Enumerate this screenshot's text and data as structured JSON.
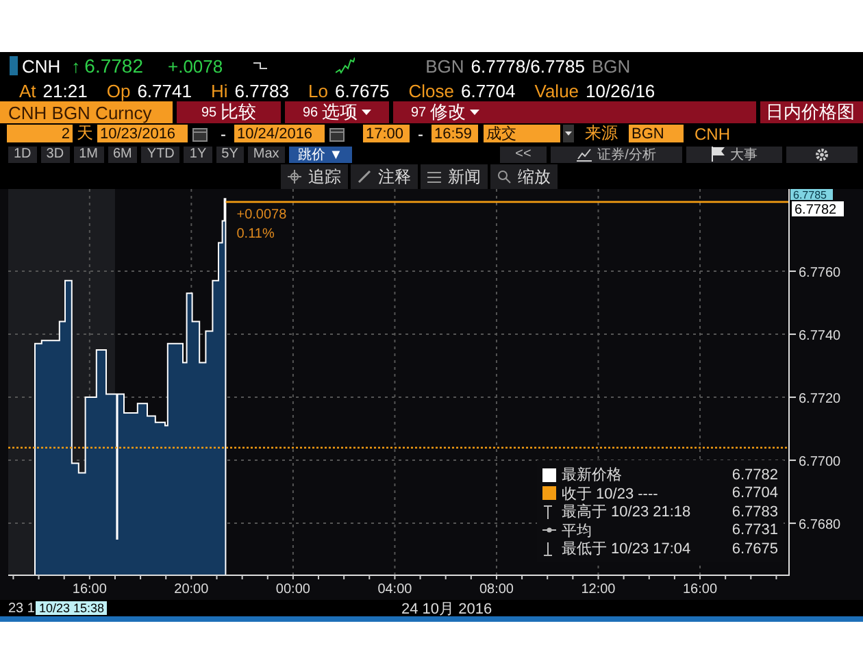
{
  "quote": {
    "ticker": "CNH",
    "arrow": "↑",
    "last": "6.7782",
    "change": "+.0078",
    "bid_source": "BGN",
    "bid_ask": "6.7778/6.7785",
    "ask_source": "BGN"
  },
  "stats": [
    {
      "label": "At",
      "value": "21:21"
    },
    {
      "label": "Op",
      "value": "6.7741"
    },
    {
      "label": "Hi",
      "value": "6.7783"
    },
    {
      "label": "Lo",
      "value": "6.7675"
    },
    {
      "label": "Close",
      "value": "6.7704"
    },
    {
      "label": "Value",
      "value": "10/26/16"
    }
  ],
  "title_bar": {
    "security": "CNH BGN Curncy",
    "actions": [
      {
        "code": "95",
        "label": "比较",
        "dropdown": false
      },
      {
        "code": "96",
        "label": "选项",
        "dropdown": true
      },
      {
        "code": "97",
        "label": "修改",
        "dropdown": true
      }
    ],
    "title": "日内价格图"
  },
  "range": {
    "days": "2",
    "unit": "天",
    "start_date": "10/23/2016",
    "date_separator": "-",
    "end_date": "10/24/2016",
    "start_time": "17:00",
    "time_separator": "-",
    "end_time": "16:59",
    "event": "成交",
    "source_label": "来源",
    "source": "BGN",
    "currency": "CNH"
  },
  "periods": [
    "1D",
    "3D",
    "1M",
    "6M",
    "YTD",
    "1Y",
    "5Y",
    "Max"
  ],
  "mode": "跳价 ▼",
  "right_buttons": [
    {
      "kind": "collapse",
      "label": "<<"
    },
    {
      "kind": "analysis",
      "label": "证券/分析"
    },
    {
      "kind": "events",
      "label": "大事"
    },
    {
      "kind": "settings"
    }
  ],
  "tools": [
    {
      "kind": "track",
      "label": "追踪"
    },
    {
      "kind": "annotate",
      "label": "注释"
    },
    {
      "kind": "news",
      "label": "新闻"
    },
    {
      "kind": "zoom",
      "label": "缩放"
    }
  ],
  "chart": {
    "ask_tag": "6.7785",
    "price_tag": "6.7782",
    "chart_data": {
      "type": "area",
      "grid": true,
      "xlim": [
        "2016-10-23 12:48",
        "2016-10-24 19:30"
      ],
      "ylim": [
        6.76635,
        6.77861
      ],
      "xticks": [
        {
          "value": "2016-10-23 16:00",
          "label": "16:00"
        },
        {
          "value": "2016-10-23 20:00",
          "label": "20:00"
        },
        {
          "value": "2016-10-24 00:00",
          "label": "00:00"
        },
        {
          "value": "2016-10-24 04:00",
          "label": "04:00"
        },
        {
          "value": "2016-10-24 08:00",
          "label": "08:00"
        },
        {
          "value": "2016-10-24 12:00",
          "label": "12:00"
        },
        {
          "value": "2016-10-24 16:00",
          "label": "16:00"
        }
      ],
      "yticks": [
        {
          "value": 6.768,
          "label": "6.7680"
        },
        {
          "value": 6.77,
          "label": "6.7700"
        },
        {
          "value": 6.772,
          "label": "6.7720"
        },
        {
          "value": 6.774,
          "label": "6.7740"
        },
        {
          "value": 6.776,
          "label": "6.7760"
        }
      ],
      "x": [
        "2016-10-23 13:51",
        "2016-10-23 14:07",
        "2016-10-23 14:29",
        "2016-10-23 14:49",
        "2016-10-23 15:02",
        "2016-10-23 15:18",
        "2016-10-23 15:34",
        "2016-10-23 15:50",
        "2016-10-23 16:16",
        "2016-10-23 16:39",
        "2016-10-23 17:04",
        "2016-10-23 17:06",
        "2016-10-23 17:21",
        "2016-10-23 17:53",
        "2016-10-23 18:16",
        "2016-10-23 18:35",
        "2016-10-23 18:58",
        "2016-10-23 19:04",
        "2016-10-23 19:40",
        "2016-10-23 19:49",
        "2016-10-23 20:02",
        "2016-10-23 20:19",
        "2016-10-23 20:34",
        "2016-10-23 20:50",
        "2016-10-23 21:04",
        "2016-10-23 21:13",
        "2016-10-23 21:18",
        "2016-10-23 21:21"
      ],
      "series": [
        {
          "name": "最新价格",
          "color": "#14395f",
          "values": [
            6.7737,
            6.7738,
            6.7738,
            6.7744,
            6.7757,
            6.7699,
            6.7696,
            6.772,
            6.7735,
            6.7721,
            6.7675,
            6.7721,
            6.7715,
            6.7718,
            6.7714,
            6.7712,
            6.7711,
            6.7737,
            6.7731,
            6.7753,
            6.7744,
            6.7731,
            6.7741,
            6.7757,
            6.7769,
            6.7776,
            6.7783,
            6.7782
          ]
        }
      ],
      "bands": [
        {
          "axis": "x",
          "from": "2016-10-23 12:48",
          "to": "2016-10-23 17:00"
        }
      ],
      "ref_lines": [
        {
          "axis": "y",
          "value": 6.7704
        },
        {
          "axis": "y",
          "value": 6.7782
        }
      ],
      "annotations": [
        "+0.0078",
        "0.11%"
      ]
    },
    "legend": [
      {
        "kind": "last",
        "value": "6.7782"
      },
      {
        "kind": "close",
        "label": "收于 10/23 ----",
        "value": "6.7704"
      },
      {
        "kind": "high",
        "label": "最高于 10/23 21:18",
        "value": "6.7783"
      },
      {
        "kind": "average",
        "label": "平均",
        "value": "6.7731"
      },
      {
        "kind": "low",
        "label": "最低于 10/23 17:04",
        "value": "6.7675"
      }
    ],
    "day_label": "23 1",
    "cursor_label": "10/23 15:38",
    "date_label": "24 10月 2016"
  }
}
